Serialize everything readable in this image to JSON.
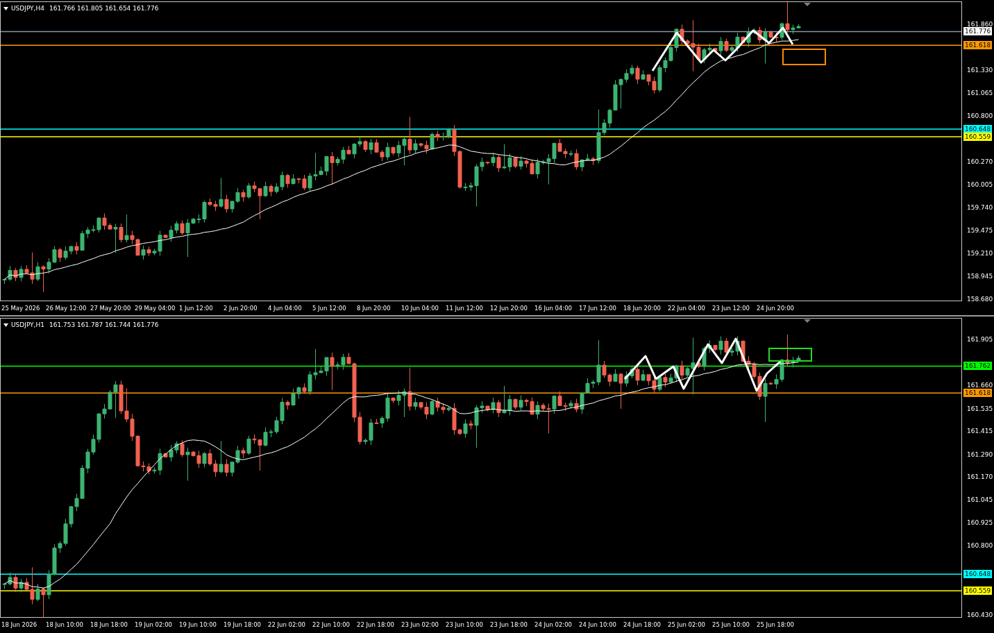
{
  "panels": [
    {
      "symbol": "USDJPY,H4",
      "ohlc": "161.766 161.805 161.654 161.776",
      "price_ticks": [
        "161.860",
        "161.330",
        "161.065",
        "160.800",
        "160.270",
        "160.005",
        "159.740",
        "159.475",
        "159.210",
        "158.945",
        "158.680"
      ],
      "levels": [
        {
          "kind": "last",
          "price": "161.776",
          "color": "#ffffff"
        },
        {
          "kind": "level",
          "price": "161.618",
          "color": "#ff9900"
        },
        {
          "kind": "level",
          "price": "160.648",
          "color": "#00ffff"
        },
        {
          "kind": "level",
          "price": "160.559",
          "color": "#ffff00"
        }
      ],
      "time_labels": [
        "25 May 2026",
        "26 May 12:00",
        "27 May 20:00",
        "29 May 04:00",
        "1 Jun 12:00",
        "2 Jun 20:00",
        "4 Jun 04:00",
        "5 Jun 12:00",
        "8 Jun 20:00",
        "10 Jun 04:00",
        "11 Jun 12:00",
        "12 Jun 20:00",
        "16 Jun 04:00",
        "17 Jun 12:00",
        "18 Jun 20:00",
        "22 Jun 04:00",
        "23 Jun 12:00",
        "24 Jun 20:00"
      ]
    },
    {
      "symbol": "USDJPY,H1",
      "ohlc": "161.753 161.787 161.744 161.776",
      "price_ticks": [
        "161.905",
        "161.660",
        "161.535",
        "161.415",
        "161.290",
        "161.170",
        "161.045",
        "160.925",
        "160.800",
        "160.430"
      ],
      "levels": [
        {
          "kind": "level",
          "price": "161.762",
          "color": "#00ff00"
        },
        {
          "kind": "level",
          "price": "161.618",
          "color": "#ff9900"
        },
        {
          "kind": "level",
          "price": "160.648",
          "color": "#00ffff"
        },
        {
          "kind": "level",
          "price": "160.559",
          "color": "#ffff00"
        }
      ],
      "time_labels": [
        "18 Jun 2026",
        "18 Jun 10:00",
        "18 Jun 18:00",
        "19 Jun 02:00",
        "19 Jun 10:00",
        "19 Jun 18:00",
        "22 Jun 02:00",
        "22 Jun 10:00",
        "22 Jun 18:00",
        "23 Jun 02:00",
        "23 Jun 10:00",
        "23 Jun 18:00",
        "24 Jun 02:00",
        "24 Jun 10:00",
        "24 Jun 18:00",
        "25 Jun 02:00",
        "25 Jun 10:00",
        "25 Jun 18:00"
      ]
    }
  ]
}
